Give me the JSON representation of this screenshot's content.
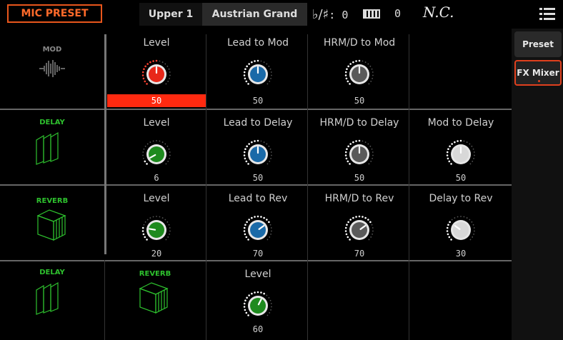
{
  "topbar": {
    "title": "MIC PRESET",
    "part": "Upper 1",
    "sound": "Austrian Grand",
    "keysig_value": ": 0",
    "transpose_value": "0",
    "chord": "N.C."
  },
  "sidebar": {
    "items": [
      {
        "label": "Preset"
      },
      {
        "label": "FX Mixer"
      }
    ]
  },
  "rows": [
    {
      "fx": {
        "label": "MOD",
        "color": "#8a8a8a"
      },
      "knobs": [
        {
          "label": "Level",
          "value": "50",
          "level": 0.5,
          "color": "#e8281a"
        },
        {
          "label": "Lead to Mod",
          "value": "50",
          "level": 0.5,
          "color": "#1a6aa8"
        },
        {
          "label": "HRM/D to Mod",
          "value": "50",
          "level": 0.5,
          "color": "#5a5a5a"
        }
      ]
    },
    {
      "fx": {
        "label": "DELAY",
        "color": "#2ec22e"
      },
      "knobs": [
        {
          "label": "Level",
          "value": "6",
          "level": 0.06,
          "color": "#1e8a1e"
        },
        {
          "label": "Lead to Delay",
          "value": "50",
          "level": 0.5,
          "color": "#1a6aa8"
        },
        {
          "label": "HRM/D to Delay",
          "value": "50",
          "level": 0.5,
          "color": "#5a5a5a"
        },
        {
          "label": "Mod to Delay",
          "value": "50",
          "level": 0.5,
          "color": "#d8d8d8"
        }
      ]
    },
    {
      "fx": {
        "label": "REVERB",
        "color": "#2ec22e"
      },
      "knobs": [
        {
          "label": "Level",
          "value": "20",
          "level": 0.2,
          "color": "#1e8a1e"
        },
        {
          "label": "Lead to Rev",
          "value": "70",
          "level": 0.7,
          "color": "#1a6aa8"
        },
        {
          "label": "HRM/D to Rev",
          "value": "70",
          "level": 0.7,
          "color": "#5a5a5a"
        },
        {
          "label": "Delay to Rev",
          "value": "30",
          "level": 0.3,
          "color": "#d8d8d8"
        }
      ]
    },
    {
      "fx": {
        "label": "DELAY",
        "color": "#2ec22e"
      },
      "fx2": {
        "label": "REVERB",
        "color": "#2ec22e"
      },
      "knobs": [
        {
          "label": "Level",
          "value": "60",
          "level": 0.6,
          "color": "#1e8a1e"
        }
      ]
    }
  ]
}
